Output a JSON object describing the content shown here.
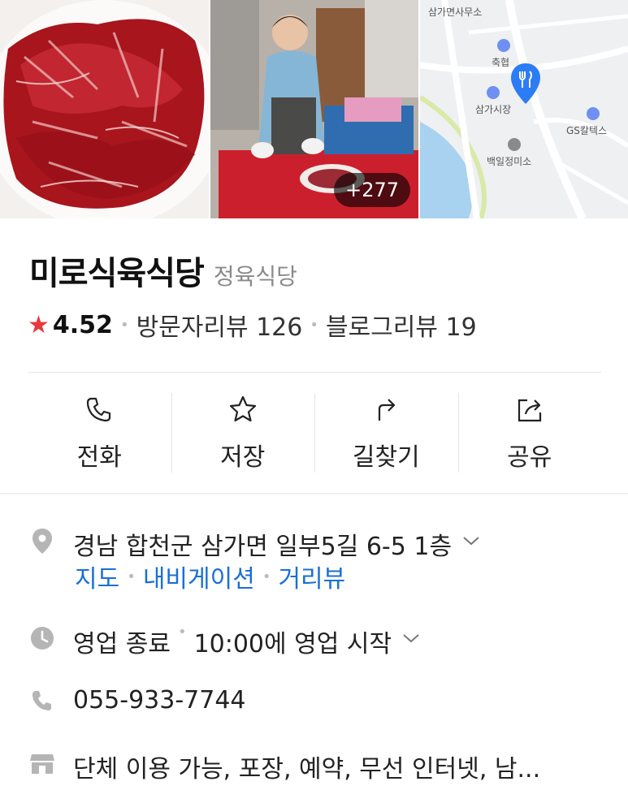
{
  "photos": {
    "more_count": "+277",
    "map_labels": [
      "삼가면사무소",
      "축협",
      "삼가시장",
      "GS칼텍스",
      "백일정미소"
    ]
  },
  "place": {
    "name": "미로식육식당",
    "category": "정육식당",
    "rating": "4.52",
    "visitor_reviews": "방문자리뷰 126",
    "blog_reviews": "블로그리뷰 19"
  },
  "actions": [
    {
      "label": "전화",
      "icon": "phone-icon"
    },
    {
      "label": "저장",
      "icon": "star-outline-icon"
    },
    {
      "label": "길찾기",
      "icon": "directions-icon"
    },
    {
      "label": "공유",
      "icon": "share-icon"
    }
  ],
  "info": {
    "address": "경남 합천군 삼가면 일부5길 6-5 1층",
    "address_links": [
      "지도",
      "내비게이션",
      "거리뷰"
    ],
    "hours_status": "영업 종료",
    "hours_next": "10:00에 영업 시작",
    "phone": "055-933-7744",
    "amenities": "단체 이용 가능, 포장, 예약, 무선 인터넷, 남..."
  },
  "colors": {
    "star": "#e8383d",
    "link": "#1a6fd6",
    "map_pin": "#2c7cf6"
  }
}
